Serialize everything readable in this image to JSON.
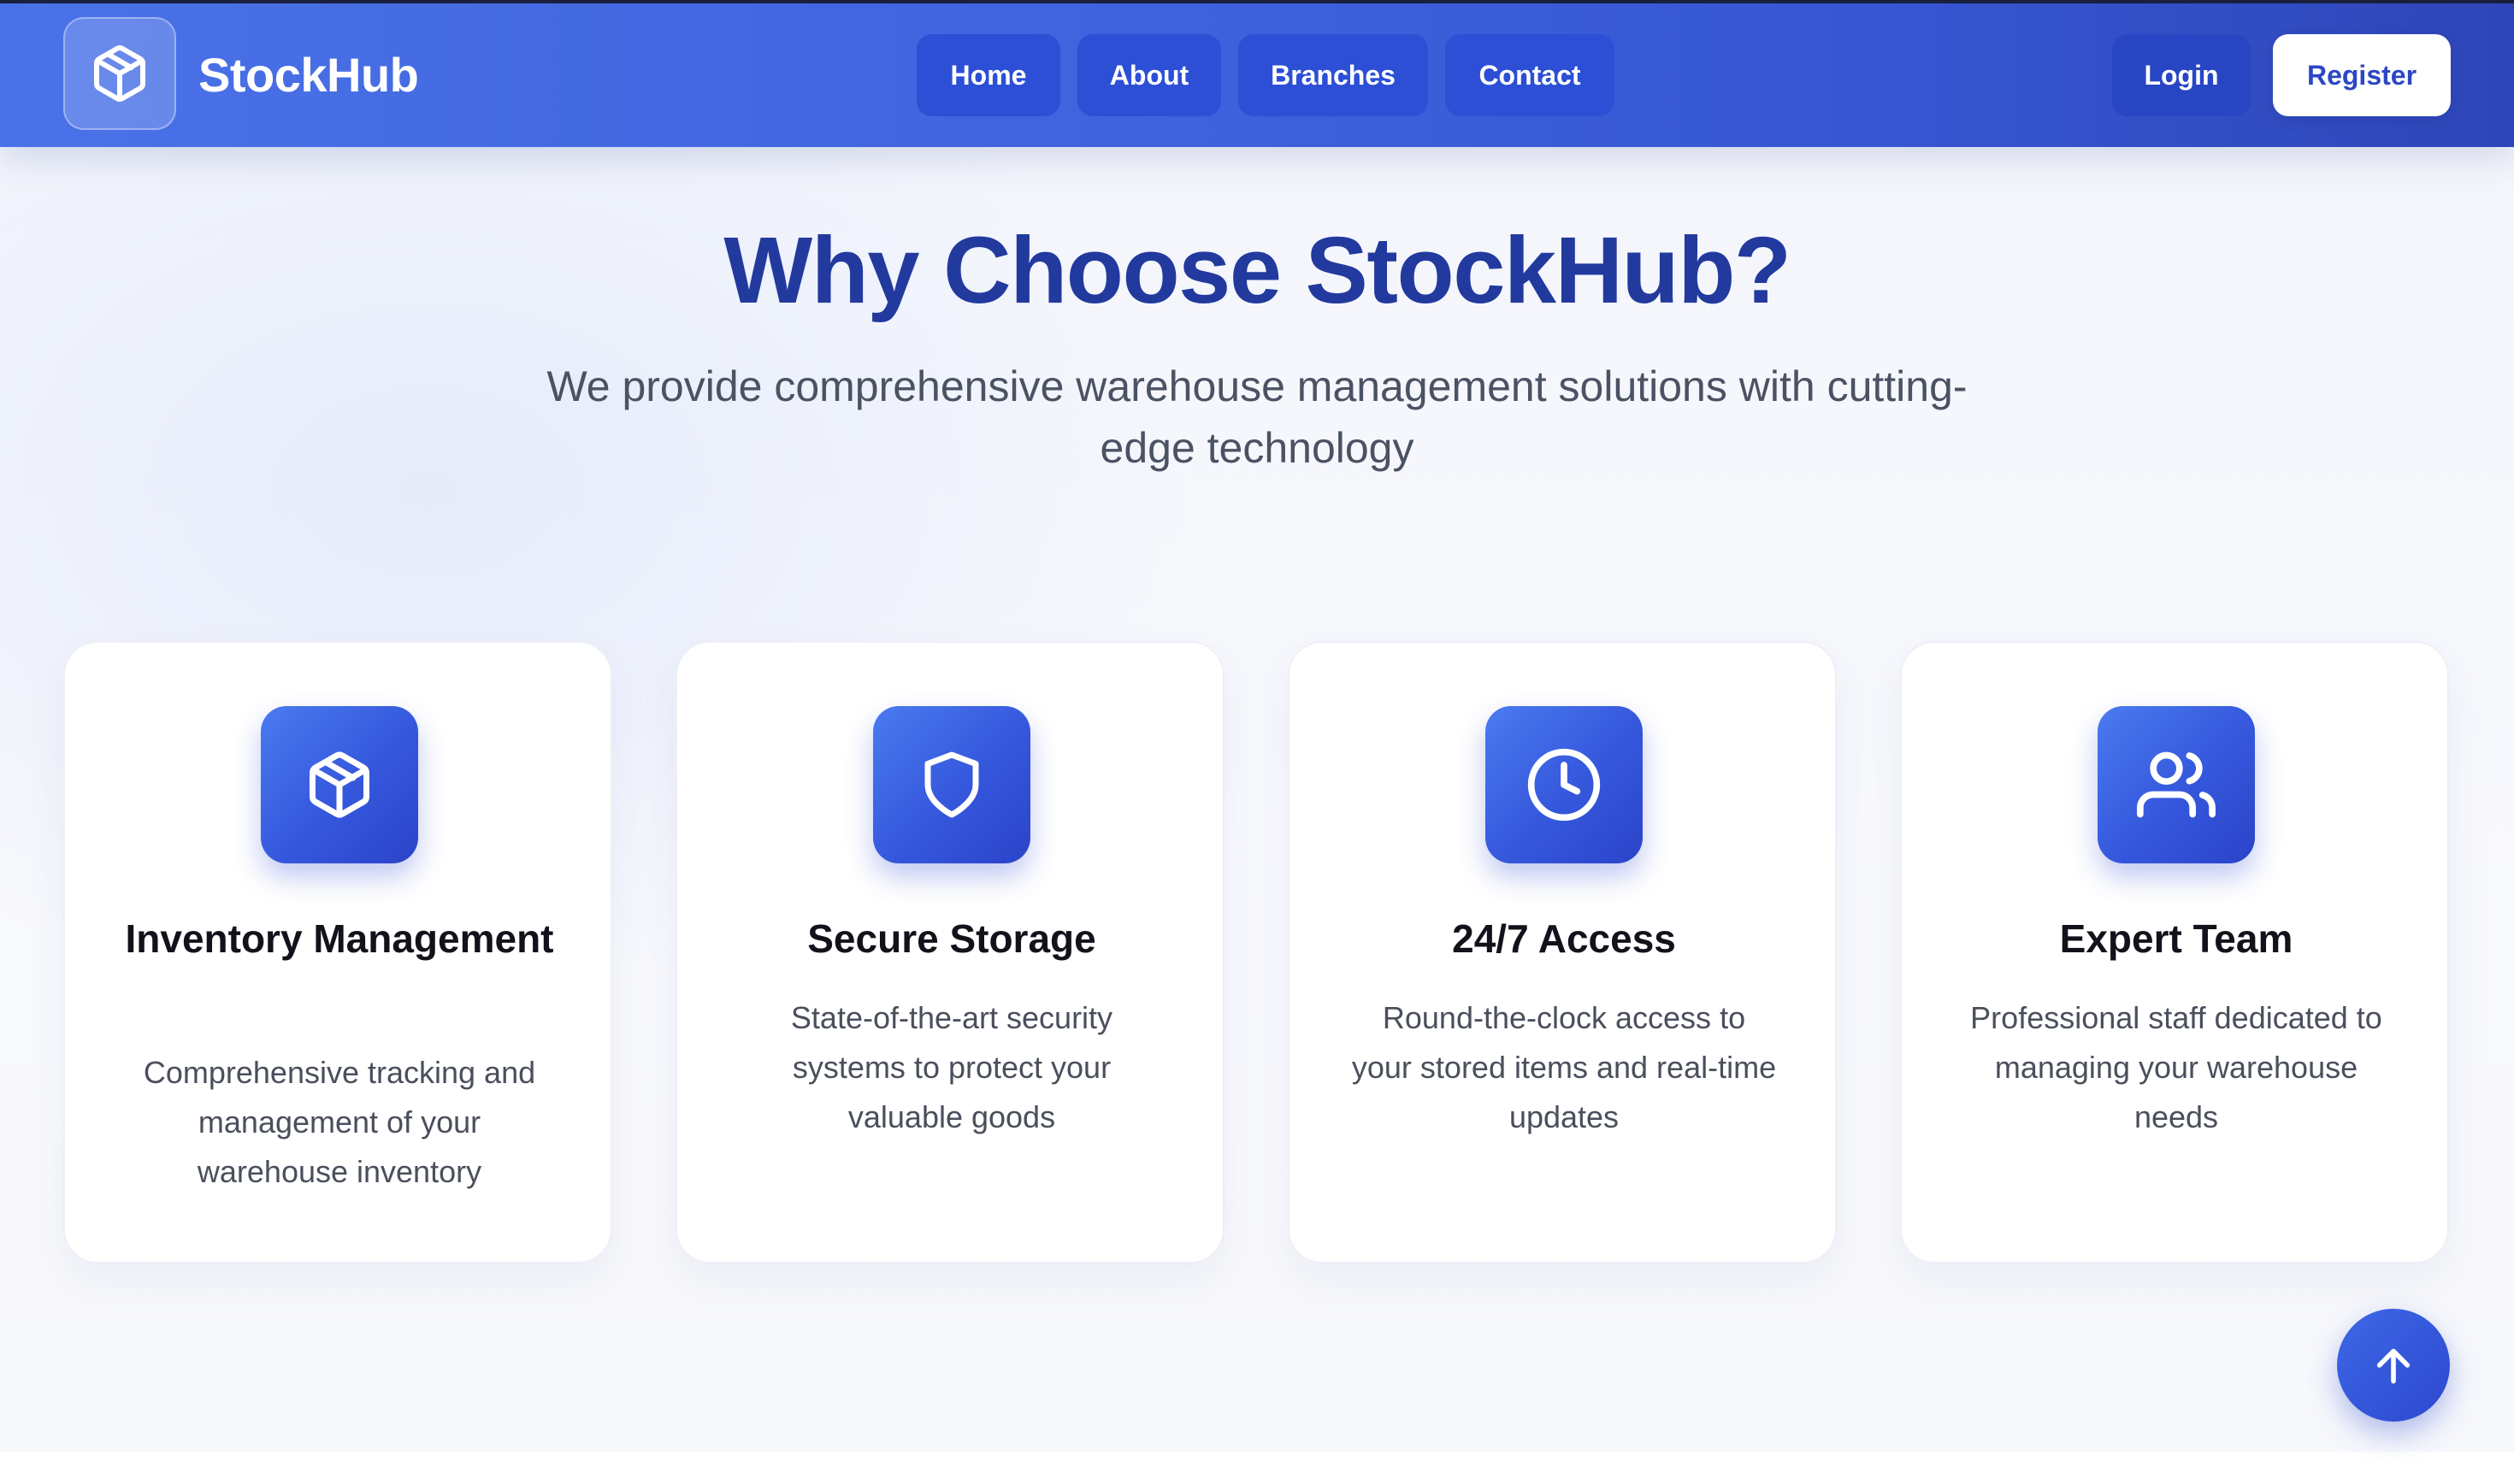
{
  "header": {
    "brand": "StockHub",
    "logo_icon": "box-icon",
    "nav": [
      {
        "label": "Home"
      },
      {
        "label": "About"
      },
      {
        "label": "Branches"
      },
      {
        "label": "Contact"
      }
    ],
    "login_label": "Login",
    "register_label": "Register"
  },
  "features": {
    "title": "Why Choose StockHub?",
    "subtitle": "We provide comprehensive warehouse management solutions with cutting-edge technology",
    "cards": [
      {
        "icon": "box-icon",
        "title": "Inventory Management",
        "description": "Comprehensive tracking and management of your warehouse inventory"
      },
      {
        "icon": "shield-icon",
        "title": "Secure Storage",
        "description": "State-of-the-art security systems to protect your valuable goods"
      },
      {
        "icon": "clock-icon",
        "title": "24/7 Access",
        "description": "Round-the-clock access to your stored items and real-time updates"
      },
      {
        "icon": "users-icon",
        "title": "Expert Team",
        "description": "Professional staff dedicated to managing your warehouse needs"
      }
    ]
  },
  "scroll_top_icon": "arrow-up-icon",
  "colors": {
    "header_gradient_start": "#4a72e8",
    "header_gradient_end": "#2f46b8",
    "title": "#223a9e",
    "accent": "#3557dc",
    "card_background": "#ffffff"
  }
}
